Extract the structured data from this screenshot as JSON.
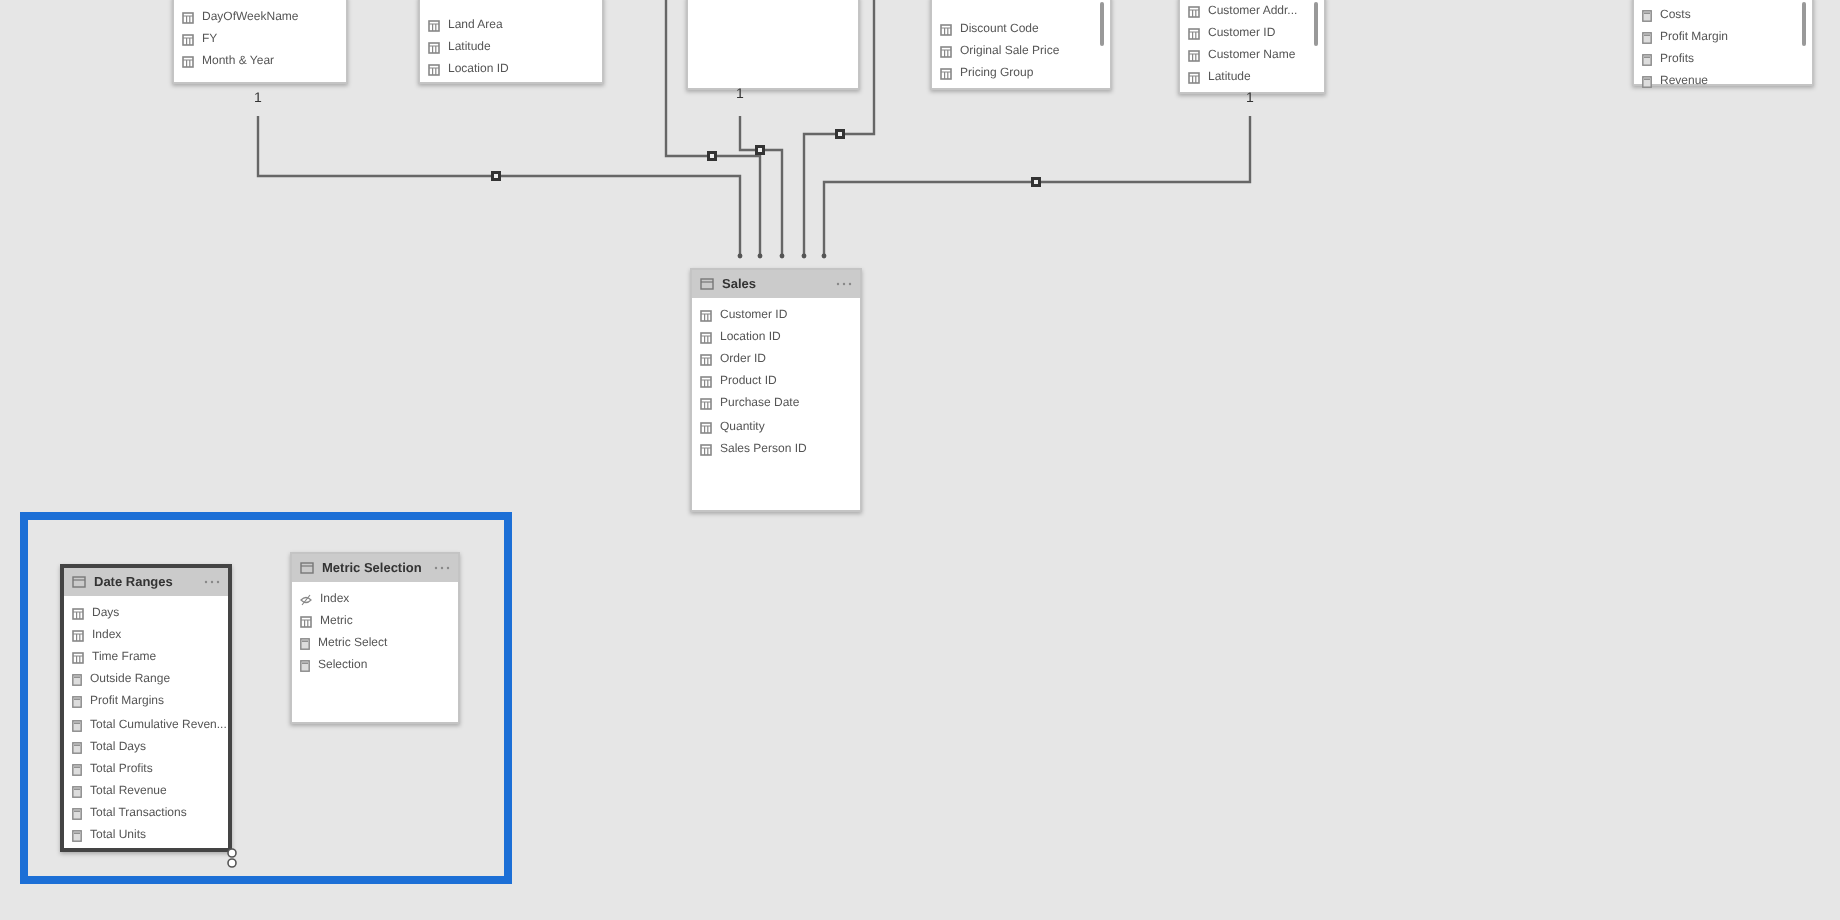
{
  "top_tables": [
    {
      "fields": [
        {
          "name": "DayOfWeekName",
          "kind": "column"
        },
        {
          "name": "FY",
          "kind": "column"
        },
        {
          "name": "Month & Year",
          "kind": "column"
        }
      ],
      "cardinality": "1"
    },
    {
      "fields": [
        {
          "name": "Land Area",
          "kind": "column"
        },
        {
          "name": "Latitude",
          "kind": "column"
        },
        {
          "name": "Location ID",
          "kind": "column"
        }
      ]
    },
    {
      "cardinality": "1"
    },
    {
      "fields": [
        {
          "name": "Discount Code",
          "kind": "column"
        },
        {
          "name": "Original Sale Price",
          "kind": "column"
        },
        {
          "name": "Pricing Group",
          "kind": "column"
        }
      ],
      "scrollbar": true
    },
    {
      "fields": [
        {
          "name": "Customer Addr...",
          "kind": "column"
        },
        {
          "name": "Customer ID",
          "kind": "column"
        },
        {
          "name": "Customer Name",
          "kind": "column"
        },
        {
          "name": "Latitude",
          "kind": "column"
        }
      ],
      "scrollbar": true,
      "cardinality": "1"
    },
    {
      "fields": [
        {
          "name": "Costs",
          "kind": "measure"
        },
        {
          "name": "Profit Margin",
          "kind": "measure"
        },
        {
          "name": "Profits",
          "kind": "measure"
        },
        {
          "name": "Revenue",
          "kind": "measure"
        }
      ],
      "scrollbar": true
    }
  ],
  "sales_table": {
    "title": "Sales",
    "selected": false,
    "fields": [
      {
        "name": "Customer ID",
        "kind": "column"
      },
      {
        "name": "Location ID",
        "kind": "column"
      },
      {
        "name": "Order ID",
        "kind": "column"
      },
      {
        "name": "Product ID",
        "kind": "column"
      },
      {
        "name": "Purchase Date",
        "kind": "column"
      },
      {
        "name": "Quantity",
        "kind": "column"
      },
      {
        "name": "Sales Person ID",
        "kind": "column"
      }
    ]
  },
  "highlight_group": {
    "highlighted": true,
    "tables": [
      {
        "title": "Date Ranges",
        "selected": true,
        "fields": [
          {
            "name": "Days",
            "kind": "column"
          },
          {
            "name": "Index",
            "kind": "column"
          },
          {
            "name": "Time Frame",
            "kind": "column"
          },
          {
            "name": "Outside Range",
            "kind": "measure"
          },
          {
            "name": "Profit Margins",
            "kind": "measure"
          },
          {
            "name": "Total Cumulative Reven...",
            "kind": "measure"
          },
          {
            "name": "Total Days",
            "kind": "measure"
          },
          {
            "name": "Total Profits",
            "kind": "measure"
          },
          {
            "name": "Total Revenue",
            "kind": "measure"
          },
          {
            "name": "Total Transactions",
            "kind": "measure"
          },
          {
            "name": "Total Units",
            "kind": "measure"
          }
        ]
      },
      {
        "title": "Metric Selection",
        "selected": false,
        "fields": [
          {
            "name": "Index",
            "kind": "hidden"
          },
          {
            "name": "Metric",
            "kind": "column"
          },
          {
            "name": "Metric Select",
            "kind": "measure"
          },
          {
            "name": "Selection",
            "kind": "measure"
          }
        ]
      }
    ]
  }
}
